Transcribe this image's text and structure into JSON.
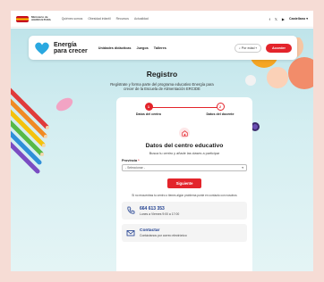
{
  "topbar": {
    "gov_line1": "Ministerio de",
    "gov_line2": "AGRICULTURA",
    "links": [
      "Quiénes somos",
      "Obesidad infantil",
      "Recursos",
      "Actualidad"
    ],
    "language": "Castellano"
  },
  "nav": {
    "brand_line1": "Energía",
    "brand_line2": "para crecer",
    "links": [
      "Unidades didácticas",
      "Juegos",
      "Talleres"
    ],
    "user_chip": "Por edad",
    "access_label": "Acceder"
  },
  "page": {
    "title": "Registro",
    "subtitle": "Regístrate y forma parte del programa educativo Energía para crecer de la Escuela de Alimentación ERCIDE"
  },
  "steps": [
    {
      "number": "1",
      "label": "Datos del centro"
    },
    {
      "number": "2",
      "label": "Datos del docente"
    }
  ],
  "form": {
    "title": "Datos del centro educativo",
    "subtitle": "Busca tu centro y añade las clases a participar",
    "province_label": "Provincia",
    "province_required": "*",
    "province_value": "- Seleccionar -",
    "next_label": "Siguiente",
    "not_found": "Si no encuentras tu centro o tienes algún problema ponte en contacto con nosotros"
  },
  "contact_phone": {
    "number": "664 613 353",
    "hours": "Lunes a Viernes 9:00 a 17:00"
  },
  "contact_mail": {
    "title": "Contactar",
    "subtitle": "Contáctanos por correo electrónico"
  },
  "colors": {
    "accent": "#e3242b",
    "brand_blue": "#1d3d8f",
    "hero_bg": "#bfe4ea",
    "page_bg": "#f6dcd5"
  }
}
